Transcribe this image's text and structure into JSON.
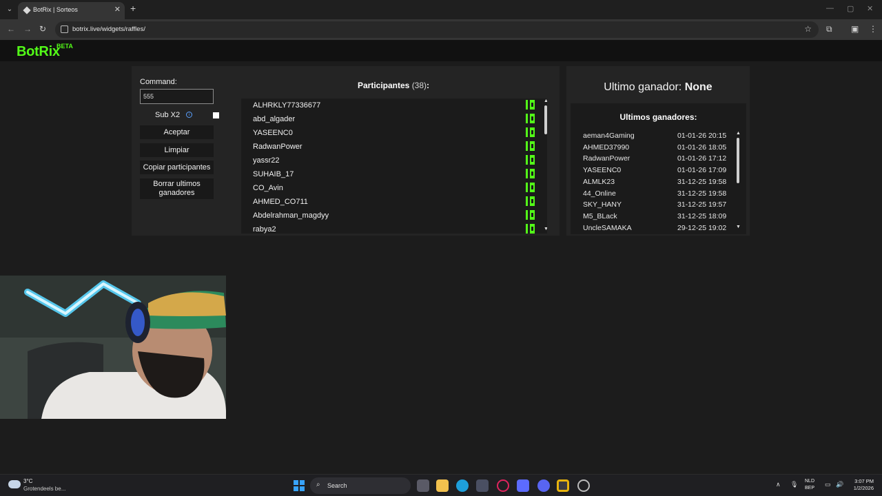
{
  "browser": {
    "tab_title": "BotRix | Sorteos",
    "url": "botrix.live/widgets/raffles/"
  },
  "site": {
    "logo": "BotRix",
    "beta": "BETA"
  },
  "controls": {
    "command_label": "Command:",
    "command_value": "555",
    "sub_label": "Sub X2",
    "accept": "Aceptar",
    "clear": "Limpiar",
    "copy": "Copiar participantes",
    "clear_winners_1": "Borrar ultimos",
    "clear_winners_2": "ganadores"
  },
  "participants": {
    "label": "Participantes",
    "count": "(38)",
    "colon": ":",
    "items": [
      "ALHRKLY77336677",
      "abd_algader",
      "YASEENC0",
      "RadwanPower",
      "yassr22",
      "SUHAIB_17",
      "CO_Avin",
      "AHMED_CO711",
      "Abdelrahman_magdyy",
      "rabya2"
    ]
  },
  "last_winner": {
    "label": "Ultimo ganador:",
    "value": "None"
  },
  "recent_winners": {
    "title": "Ultimos ganadores:",
    "items": [
      {
        "name": "aeman4Gaming",
        "date": "01-01-26 20:15"
      },
      {
        "name": "AHMED37990",
        "date": "01-01-26 18:05"
      },
      {
        "name": "RadwanPower",
        "date": "01-01-26 17:12"
      },
      {
        "name": "YASEENC0",
        "date": "01-01-26 17:09"
      },
      {
        "name": "ALMLK23",
        "date": "31-12-25 19:58"
      },
      {
        "name": "44_Online",
        "date": "31-12-25 19:58"
      },
      {
        "name": "SKY_HANY",
        "date": "31-12-25 19:57"
      },
      {
        "name": "M5_BLack",
        "date": "31-12-25 18:09"
      },
      {
        "name": "UncleSAMAKA",
        "date": "29-12-25 19:02"
      }
    ]
  },
  "taskbar": {
    "temp": "3°C",
    "weather": "Grotendeels be...",
    "search": "Search",
    "lang1": "NLD",
    "lang2": "BEP",
    "time": "3:07 PM",
    "date": "1/2/2026"
  },
  "colors": {
    "accent": "#53fc18",
    "panel": "#242424",
    "inner": "#1b1b1b",
    "info": "#5aa0ff"
  }
}
